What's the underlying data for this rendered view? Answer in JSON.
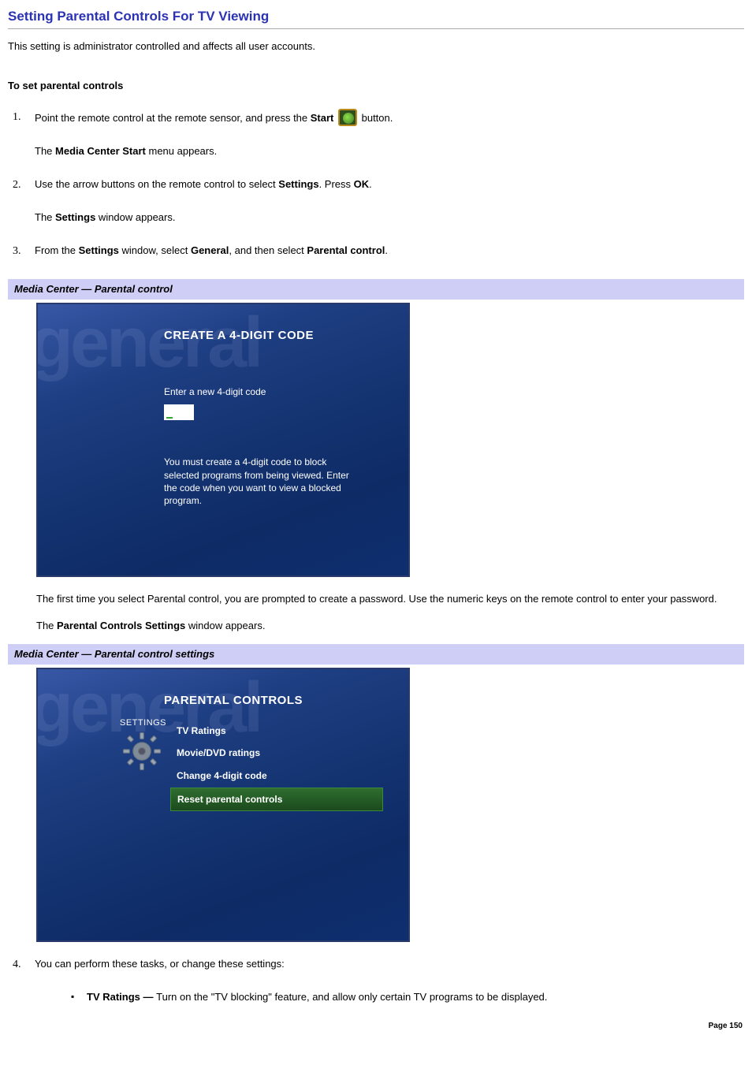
{
  "page": {
    "title": "Setting Parental Controls For TV Viewing",
    "intro": "This setting is administrator controlled and affects all user accounts.",
    "pageNumber": "Page 150"
  },
  "procedure": {
    "heading": "To set parental controls",
    "steps": {
      "1": {
        "num": "1.",
        "line1_pre": "Point the remote control at the remote sensor, and press the ",
        "line1_bold": "Start",
        "line1_post": " button.",
        "line2_pre": "The ",
        "line2_bold": "Media Center Start",
        "line2_post": " menu appears."
      },
      "2": {
        "num": "2.",
        "line1_pre": "Use the arrow buttons on the remote control to select ",
        "line1_bold1": "Settings",
        "line1_mid": ". Press ",
        "line1_bold2": "OK",
        "line1_post": ".",
        "line2_pre": "The ",
        "line2_bold": "Settings",
        "line2_post": " window appears."
      },
      "3": {
        "num": "3.",
        "line1_pre": "From the ",
        "line1_bold1": "Settings",
        "line1_mid": " window, select ",
        "line1_bold2": "General",
        "line1_mid2": ", and then select ",
        "line1_bold3": "Parental control",
        "line1_post": "."
      },
      "4": {
        "num": "4.",
        "line1": "You can perform these tasks, or change these settings:"
      }
    },
    "afterShot1_p1": "The first time you select Parental control, you are prompted to create a password. Use the numeric keys on the remote control to enter your password.",
    "afterShot1_p2_pre": "The ",
    "afterShot1_p2_bold": "Parental Controls Settings",
    "afterShot1_p2_post": " window appears."
  },
  "captions": {
    "shot1": "Media Center — Parental control",
    "shot2": "Media Center — Parental control settings"
  },
  "shot1": {
    "watermark": "general",
    "title": "CREATE A 4-DIGIT CODE",
    "label": "Enter a new 4-digit code",
    "explain": "You must create a 4-digit code to block selected programs from being viewed. Enter the code when you want to view a blocked program."
  },
  "shot2": {
    "watermark": "general",
    "title": "PARENTAL CONTROLS",
    "settingsLabel": "SETTINGS",
    "menu": {
      "0": "TV Ratings",
      "1": "Movie/DVD ratings",
      "2": "Change 4-digit code",
      "3": "Reset parental controls"
    }
  },
  "bullets": {
    "0": {
      "bold": "TV Ratings — ",
      "rest": "Turn on the \"TV blocking\" feature, and allow only certain TV programs to be displayed."
    }
  }
}
